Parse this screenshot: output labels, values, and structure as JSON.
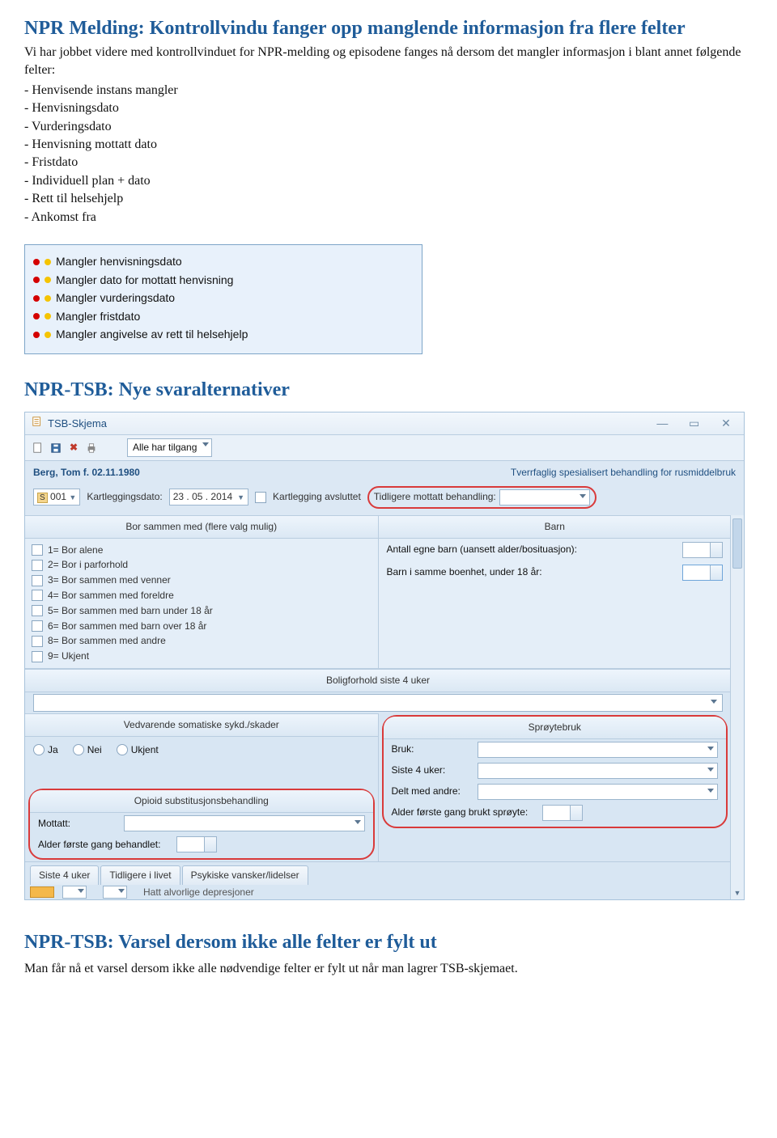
{
  "section1": {
    "title": "NPR Melding: Kontrollvindu fanger opp manglende informasjon fra flere felter",
    "intro": "Vi har jobbet videre med kontrollvinduet for NPR-melding og episodene fanges nå dersom det mangler informasjon i blant annet følgende felter:",
    "bullets": [
      "- Henvisende instans mangler",
      "- Henvisningsdato",
      "- Vurderingsdato",
      "- Henvisning mottatt dato",
      "- Fristdato",
      "- Individuell plan + dato",
      "- Rett til helsehjelp",
      "- Ankomst fra"
    ]
  },
  "infobox": {
    "items": [
      "Mangler henvisningsdato",
      "Mangler dato for mottatt henvisning",
      "Mangler vurderingsdato",
      "Mangler fristdato",
      "Mangler angivelse av rett til helsehjelp"
    ]
  },
  "section2": {
    "title": "NPR-TSB: Nye svaralternativer"
  },
  "tsb": {
    "windowTitle": "TSB-Skjema",
    "accessDropdown": "Alle har tilgang",
    "patient": "Berg, Tom f. 02.11.1980",
    "rightText": "Tverrfaglig spesialisert behandling for rusmiddelbruk",
    "seqPrefix": "S",
    "seqValue": "001",
    "kartleggingLabel": "Kartleggingsdato:",
    "kartleggingDate": "23 . 05 . 2014",
    "kartleggingAvsluttet": "Kartlegging avsluttet",
    "tidligereLabel": "Tidligere mottatt behandling:",
    "borHeader": "Bor sammen med (flere valg mulig)",
    "barnHeader": "Barn",
    "borOptions": [
      "1= Bor alene",
      "2= Bor i parforhold",
      "3= Bor sammen med venner",
      "4= Bor sammen med foreldre",
      "5= Bor sammen med barn under 18 år",
      "6= Bor sammen med barn over 18 år",
      "8= Bor sammen med andre",
      "9= Ukjent"
    ],
    "barnLine1": "Antall egne barn (uansett alder/bosituasjon):",
    "barnLine2": "Barn i samme boenhet, under 18 år:",
    "boligHeader": "Boligforhold siste 4 uker",
    "sykdHeader": "Vedvarende somatiske sykd./skader",
    "sproyteHeader": "Sprøytebruk",
    "radioJa": "Ja",
    "radioNei": "Nei",
    "radioUkjent": "Ukjent",
    "brukLabel": "Bruk:",
    "siste4Label": "Siste 4 uker:",
    "deltLabel": "Delt med andre:",
    "alderSproyteLabel": "Alder første gang brukt sprøyte:",
    "opioidHeader": "Opioid substitusjonsbehandling",
    "mottattLabel": "Mottatt:",
    "alderBehandletLabel": "Alder første gang behandlet:",
    "tab1": "Siste 4 uker",
    "tab2": "Tidligere i livet",
    "tab3": "Psykiske vansker/lidelser",
    "cutText": "Hatt alvorlige depresjoner"
  },
  "section3": {
    "title": "NPR-TSB: Varsel dersom ikke alle felter er fylt ut",
    "body": "Man får nå et varsel dersom ikke alle nødvendige felter er fylt ut når man lagrer TSB-skjemaet."
  }
}
